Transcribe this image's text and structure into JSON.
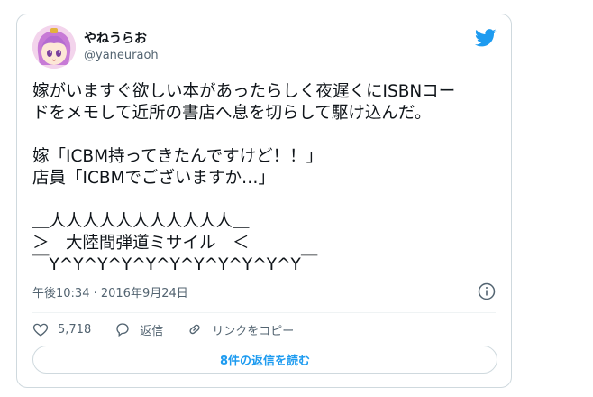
{
  "author": {
    "name": "やねうらお",
    "handle": "@yaneuraoh"
  },
  "icons": {
    "brand": "twitter-bird-icon",
    "info": "info-icon",
    "like": "heart-icon",
    "reply": "speech-bubble-icon",
    "copy_link": "link-icon"
  },
  "colors": {
    "brand": "#1d9bf0",
    "text": "#0f1419",
    "muted": "#536471",
    "border": "#cfd9de"
  },
  "tweet": {
    "lines": [
      "嫁がいますぐ欲しい本があったらしく夜遅くにISBNコー",
      "ドをメモして近所の書店へ息を切らして駆け込んだ。",
      "",
      "嫁「ICBM持ってきたんですけど！！」",
      "店員「ICBMでございますか…」",
      "",
      "＿人人人人人人人人人人人＿",
      "＞　大陸間弾道ミサイル　＜",
      "￣Y^Y^Y^Y^Y^Y^Y^Y^Y^Y^Y￣"
    ],
    "timestamp": "午後10:34 · 2016年9月24日"
  },
  "actions": {
    "likes": "5,718",
    "reply_label": "返信",
    "copy_link_label": "リンクをコピー"
  },
  "replies_button_label": "8件の返信を読む"
}
